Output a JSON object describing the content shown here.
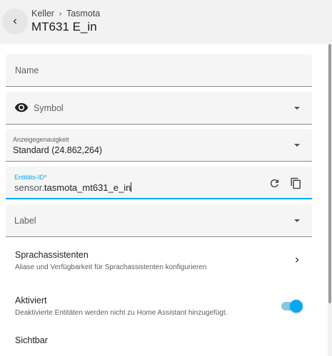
{
  "header": {
    "breadcrumb": [
      "Keller",
      "Tasmota"
    ],
    "title": "MT631 E_in"
  },
  "form": {
    "name_label": "Name",
    "symbol_label": "Symbol",
    "precision": {
      "label": "Anzeigegenauigkeit",
      "value": "Standard (24.862,264)"
    },
    "entity_id": {
      "label": "Entitäts-ID*",
      "prefix": "sensor.",
      "value": "tasmota_mt631_e_in"
    },
    "label_label": "Label"
  },
  "settings": {
    "voice": {
      "title": "Sprachassistenten",
      "subtitle": "Aliase und Verfügbarkeit für Sprachassistenten konfigurieren"
    },
    "enabled": {
      "title": "Aktiviert",
      "subtitle": "Deaktivierte Entitäten werden nicht zu Home Assistant hinzugefügt.",
      "on": true
    },
    "visible": {
      "title": "Sichtbar"
    }
  },
  "colors": {
    "accent": "#03a9f4",
    "toggle_track": "#88c6e2"
  }
}
